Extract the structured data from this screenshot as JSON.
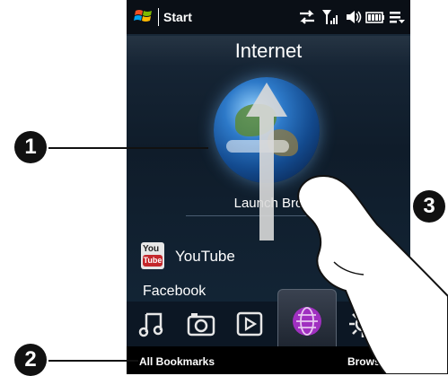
{
  "statusbar": {
    "title": "Start"
  },
  "tab": {
    "title": "Internet"
  },
  "internet": {
    "launch_label": "Launch Bro",
    "favorites": [
      {
        "label": "YouTube"
      },
      {
        "label": "Facebook"
      }
    ],
    "youtube_logo": {
      "top_text": "You",
      "bottom_text": "Tube"
    }
  },
  "tabbar": {
    "icons": [
      "music-icon",
      "camera-icon",
      "video-icon",
      "internet-icon",
      "settings-icon"
    ]
  },
  "softkeys": {
    "left": "All Bookmarks",
    "right": "Browser"
  },
  "callouts": [
    "1",
    "2",
    "3"
  ],
  "colors": {
    "accent_tab": "#a030c0",
    "youtube_red": "#c4272b"
  }
}
